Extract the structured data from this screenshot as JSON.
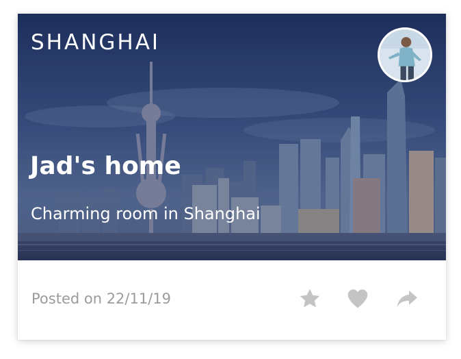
{
  "card": {
    "city": "SHANGHAI",
    "title": "Jad's home",
    "subtitle": "Charming room in Shanghai",
    "posted": "Posted on 22/11/19"
  },
  "icons": {
    "star": "star-icon",
    "heart": "heart-icon",
    "share": "share-icon"
  },
  "colors": {
    "icon": "#c4c4c4",
    "muted_text": "#9b9b9b",
    "overlay": "#1d2b55"
  }
}
